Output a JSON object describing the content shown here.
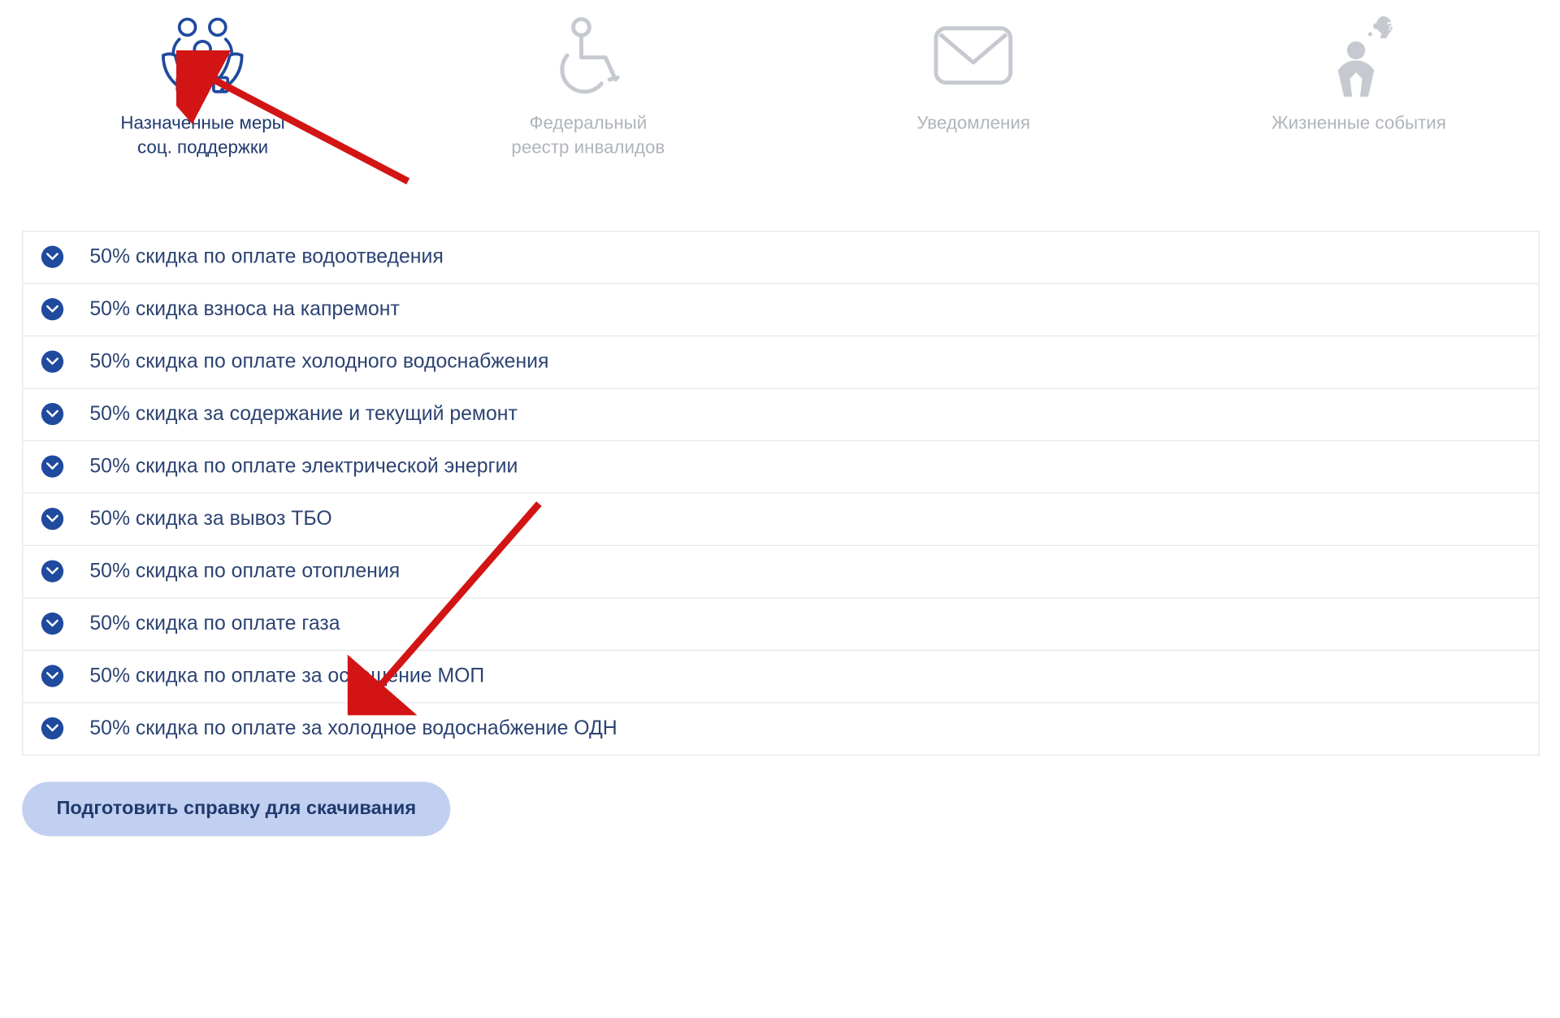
{
  "tabs": [
    {
      "line1": "Назначенные меры",
      "line2": "соц. поддержки",
      "active": true
    },
    {
      "line1": "Федеральный",
      "line2": "реестр инвалидов",
      "active": false
    },
    {
      "line1": "Уведомления",
      "line2": "",
      "active": false
    },
    {
      "line1": "Жизненные события",
      "line2": "",
      "active": false
    }
  ],
  "items": [
    "50% скидка по оплате водоотведения",
    "50% скидка взноса на капремонт",
    "50% скидка по оплате холодного водоснабжения",
    "50% скидка за содержание и текущий ремонт",
    "50% скидка по оплате электрической энергии",
    "50% скидка за вывоз ТБО",
    "50% скидка по оплате отопления",
    "50% скидка по оплате газа",
    "50% скидка по оплате за освещение МОП",
    "50% скидка по оплате за холодное водоснабжение ОДН"
  ],
  "download_label": "Подготовить справку для скачивания"
}
